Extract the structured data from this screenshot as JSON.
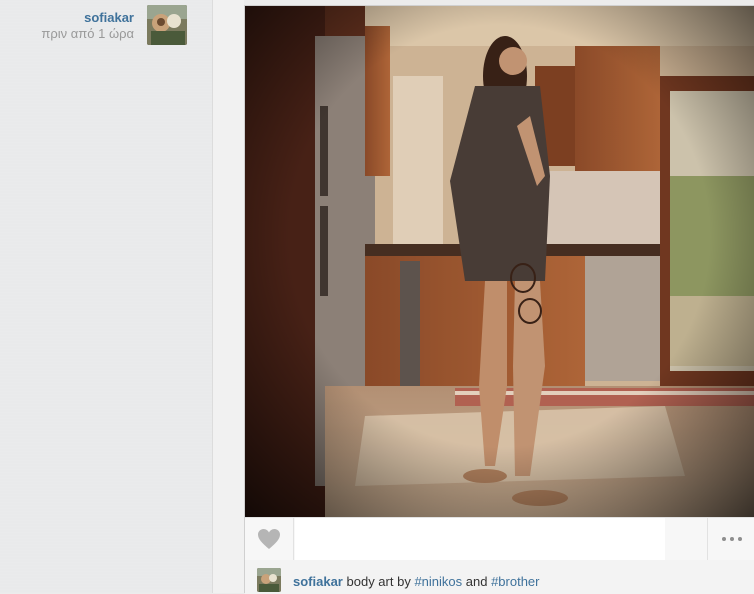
{
  "author": {
    "username": "sofiakar",
    "time": "πριν από 1 ώρα"
  },
  "post": {
    "caption": {
      "username": "sofiakar",
      "text_before": "body art by ",
      "tag1": "#ninikos",
      "middle": " and ",
      "tag2": "#brother"
    }
  },
  "icons": {
    "like": "heart-icon",
    "more": "more-options-icon"
  },
  "colors": {
    "link": "#3f729b",
    "muted": "#999999"
  }
}
